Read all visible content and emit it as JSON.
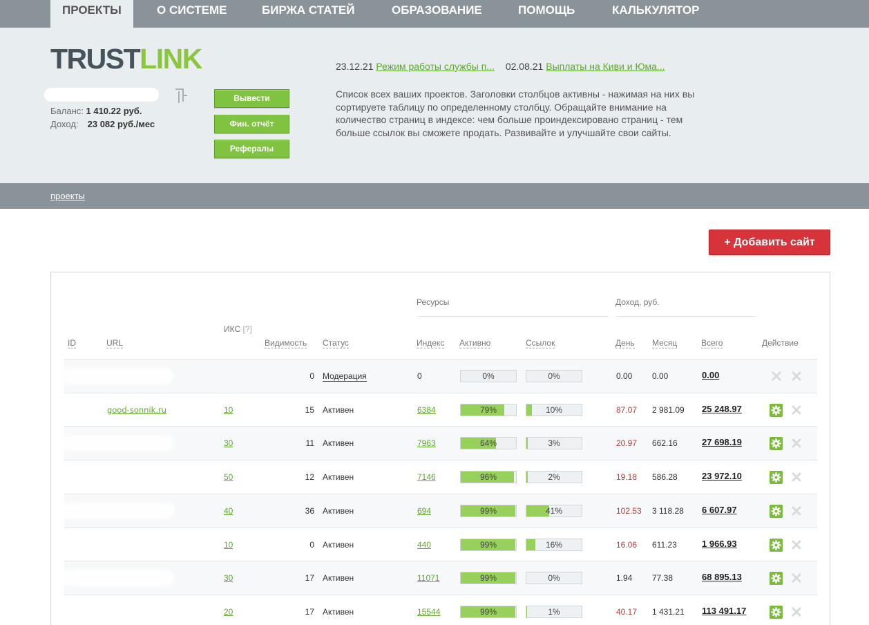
{
  "nav": {
    "tabs": [
      {
        "label": "ПРОЕКТЫ",
        "active": true
      },
      {
        "label": "О СИСТЕМЕ"
      },
      {
        "label": "БИРЖА СТАТЕЙ"
      },
      {
        "label": "ОБРАЗОВАНИЕ"
      },
      {
        "label": "ПОМОЩЬ"
      },
      {
        "label": "КАЛЬКУЛЯТОР"
      }
    ]
  },
  "logo": {
    "part1": "TRUST",
    "part2": "LINK"
  },
  "account": {
    "balance_label": "Баланс:",
    "balance_value": "1 410.22 руб.",
    "income_label": "Доход:",
    "income_value": "23 082 руб./мес"
  },
  "buttons": {
    "withdraw": "Вывести",
    "report": "Фин. отчёт",
    "referrals": "Рефералы",
    "add_site": "+ Добавить сайт"
  },
  "news": [
    {
      "date": "23.12.21",
      "title": "Режим работы службы п..."
    },
    {
      "date": "02.08.21",
      "title": "Выплаты на Киви и Юма..."
    }
  ],
  "description": "Список всех ваших проектов. Заголовки столбцов активны - нажимая на них вы сортируете таблицу по определенному столбцу. Обращайте внимание на количество страниц в индексе: чем больше проиндексировано страниц - тем больше ссылок вы сможете продать. Развивайте и улучшайте свои сайты.",
  "breadcrumb": "проекты",
  "table": {
    "group_resources": "Ресурсы",
    "group_income": "Доход,  руб.",
    "headers": {
      "id": "ID",
      "url": "URL",
      "iks": "ИКС",
      "iks_help": "[?]",
      "visibility": "Видимость",
      "status": "Статус",
      "index": "Индекс",
      "active": "Активно",
      "links": "Ссылок",
      "day": "День",
      "month": "Месяц",
      "total": "Всего",
      "action": "Действие"
    },
    "rows": [
      {
        "url": "",
        "iks": "",
        "vis": "0",
        "status": "Модерация",
        "index": "0",
        "active": "0%",
        "links": "0%",
        "day": "0.00",
        "month": "0.00",
        "total": "0.00",
        "red": false,
        "gear": false
      },
      {
        "url": "good-sonnik.ru",
        "iks": "10",
        "vis": "15",
        "status": "Активен",
        "index": "6384",
        "active": "79%",
        "links": "10%",
        "day": "87.07",
        "month": "2 981.09",
        "total": "25 248.97",
        "red": true,
        "gear": true
      },
      {
        "url": "",
        "iks": "30",
        "vis": "11",
        "status": "Активен",
        "index": "7963",
        "active": "64%",
        "links": "3%",
        "day": "20.97",
        "month": "662.16",
        "total": "27 698.19",
        "red": true,
        "gear": true
      },
      {
        "url": "",
        "iks": "50",
        "vis": "12",
        "status": "Активен",
        "index": "7146",
        "active": "96%",
        "links": "2%",
        "day": "19.18",
        "month": "586.28",
        "total": "23 972.10",
        "red": true,
        "gear": true
      },
      {
        "url": "",
        "iks": "40",
        "vis": "36",
        "status": "Активен",
        "index": "694",
        "active": "99%",
        "links": "41%",
        "day": "102.53",
        "month": "3 118.28",
        "total": "6 607.97",
        "red": true,
        "gear": true
      },
      {
        "url": "",
        "iks": "10",
        "vis": "0",
        "status": "Активен",
        "index": "440",
        "active": "99%",
        "links": "16%",
        "day": "16.06",
        "month": "611.23",
        "total": "1 966.93",
        "red": true,
        "gear": true
      },
      {
        "url": "",
        "iks": "30",
        "vis": "17",
        "status": "Активен",
        "index": "11071",
        "active": "99%",
        "links": "0%",
        "day": "1.94",
        "month": "77.38",
        "total": "68 895.13",
        "red": false,
        "gear": true
      },
      {
        "url": "",
        "iks": "20",
        "vis": "17",
        "status": "Активен",
        "index": "15544",
        "active": "99%",
        "links": "1%",
        "day": "40.17",
        "month": "1 431.21",
        "total": "113 491.17",
        "red": true,
        "gear": true
      }
    ]
  }
}
